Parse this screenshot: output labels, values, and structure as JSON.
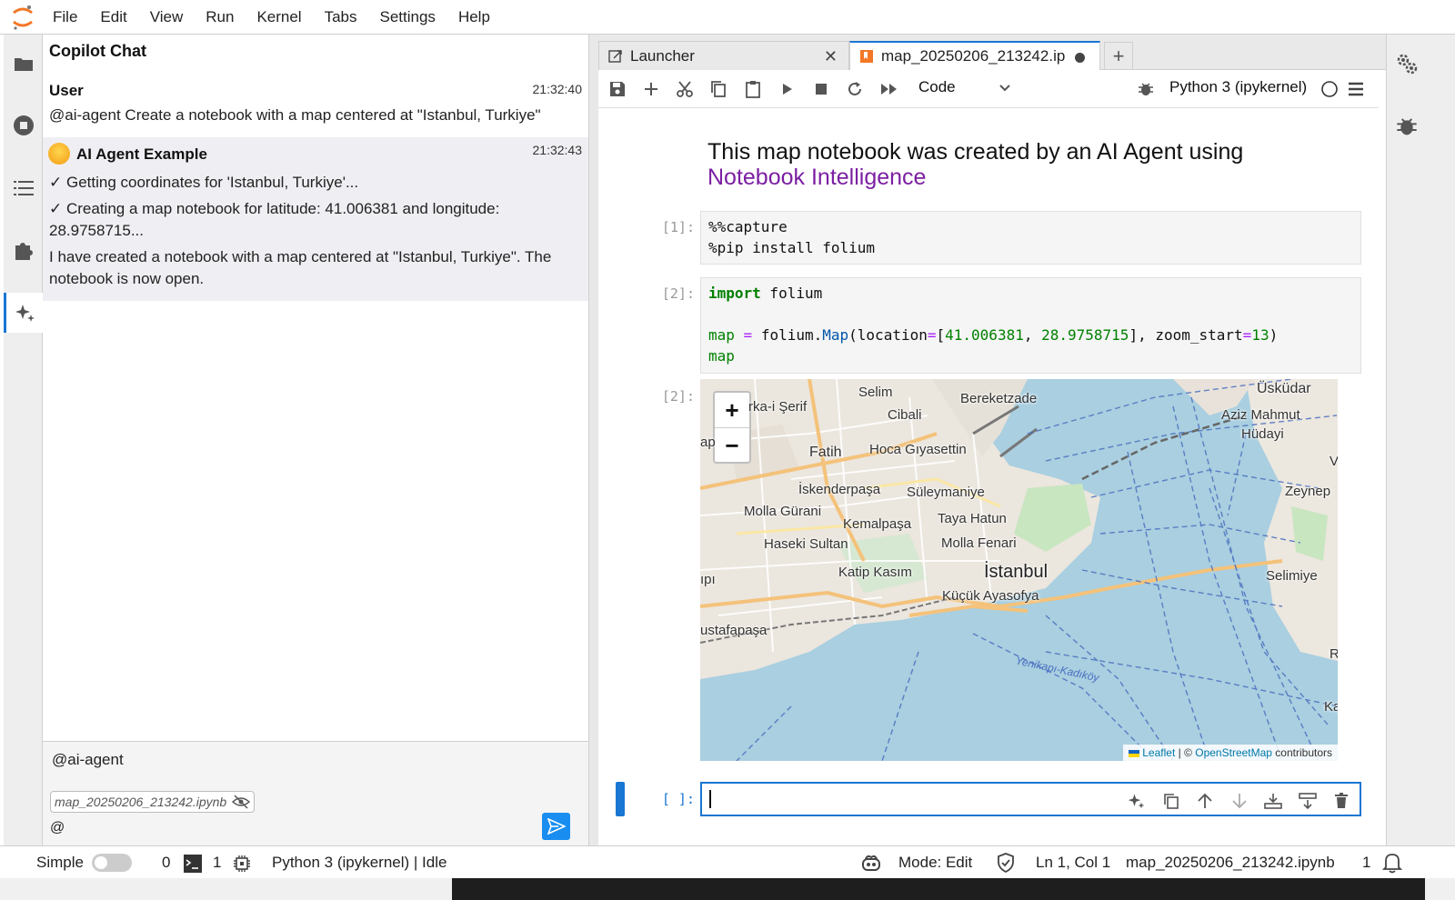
{
  "menubar": {
    "items": [
      "File",
      "Edit",
      "View",
      "Run",
      "Kernel",
      "Tabs",
      "Settings",
      "Help"
    ]
  },
  "chat": {
    "title": "Copilot Chat",
    "messages": [
      {
        "author": "User",
        "time": "21:32:40",
        "lines": [
          "@ai-agent Create a notebook with a map centered at \"Istanbul, Turkiye\""
        ]
      },
      {
        "author": "AI Agent Example",
        "time": "21:32:43",
        "lines": [
          "✓ Getting coordinates for 'Istanbul, Turkiye'...",
          "✓ Creating a map notebook for latitude: 41.006381 and longitude:",
          "28.9758715...",
          "I have created a notebook with a map centered at \"Istanbul, Turkiye\". The",
          "notebook is now open."
        ]
      }
    ],
    "input": {
      "value": "@ai-agent",
      "context_file": "map_20250206_213242.ipynb",
      "second_line": "@"
    }
  },
  "tabs": [
    {
      "label": "Launcher"
    },
    {
      "label": "map_20250206_213242.ip"
    }
  ],
  "toolbar": {
    "cell_type": "Code",
    "kernel": "Python 3 (ipykernel)"
  },
  "notebook": {
    "heading": "This map notebook was created by an AI Agent using",
    "heading_link": "Notebook Intelligence",
    "cells": [
      {
        "prompt": "[1]:",
        "lines": [
          "%%capture",
          "%pip install folium"
        ]
      },
      {
        "prompt": "[2]:",
        "code": {
          "import_kw": "import",
          "import_mod": " folium",
          "map_var": "map",
          "assign": " = ",
          "folium": "folium.",
          "map_fn": "Map",
          "args_start": "(location",
          "eq1": "=",
          "bracket_open": "[",
          "lat": "41.006381",
          "comma": ", ",
          "lon": "28.9758715",
          "bracket_close": "], zoom_start",
          "eq2": "=",
          "zoom": "13",
          "args_end": ")",
          "last_line": "map"
        }
      }
    ],
    "output_prompt": "[2]:",
    "map": {
      "zoom_in": "+",
      "zoom_out": "−",
      "labels": [
        "Selim",
        "Bereketzade",
        "Üsküdar",
        "rka-i Şerif",
        "Cibali",
        "Aziz Mahmut",
        "Hüdayi",
        "ap",
        "Fatih",
        "Hoca Gıyasettin",
        "İskenderpaşa",
        "Süleymaniye",
        "Zeynep",
        "Molla Gürani",
        "Kemalpaşa",
        "Tayа Hatun",
        "Haseki Sultan",
        "Molla Fenari",
        "Katip Kasım",
        "İstanbul",
        "Selimiye",
        "ıpı",
        "Küçük Ayasofya",
        "ustafapaşa",
        "Yenikapı-Kadıköy",
        "Ka",
        "V",
        "R"
      ],
      "attribution": {
        "leaflet": "Leaflet",
        "sep": " | © ",
        "osm": "OpenStreetMap",
        "contrib": " contributors"
      }
    },
    "empty_prompt": "[ ]:"
  },
  "statusbar": {
    "mode_label": "Simple",
    "terminals": "0",
    "kernels": "1",
    "kernel_status": "Python 3 (ipykernel) | Idle",
    "mode": "Mode: Edit",
    "position": "Ln 1, Col 1",
    "file": "map_20250206_213242.ipynb",
    "notifications": "1"
  },
  "colors": {
    "accent": "#1976d2",
    "link_purple": "#7b1fa2",
    "send_button": "#1a8ef0"
  }
}
